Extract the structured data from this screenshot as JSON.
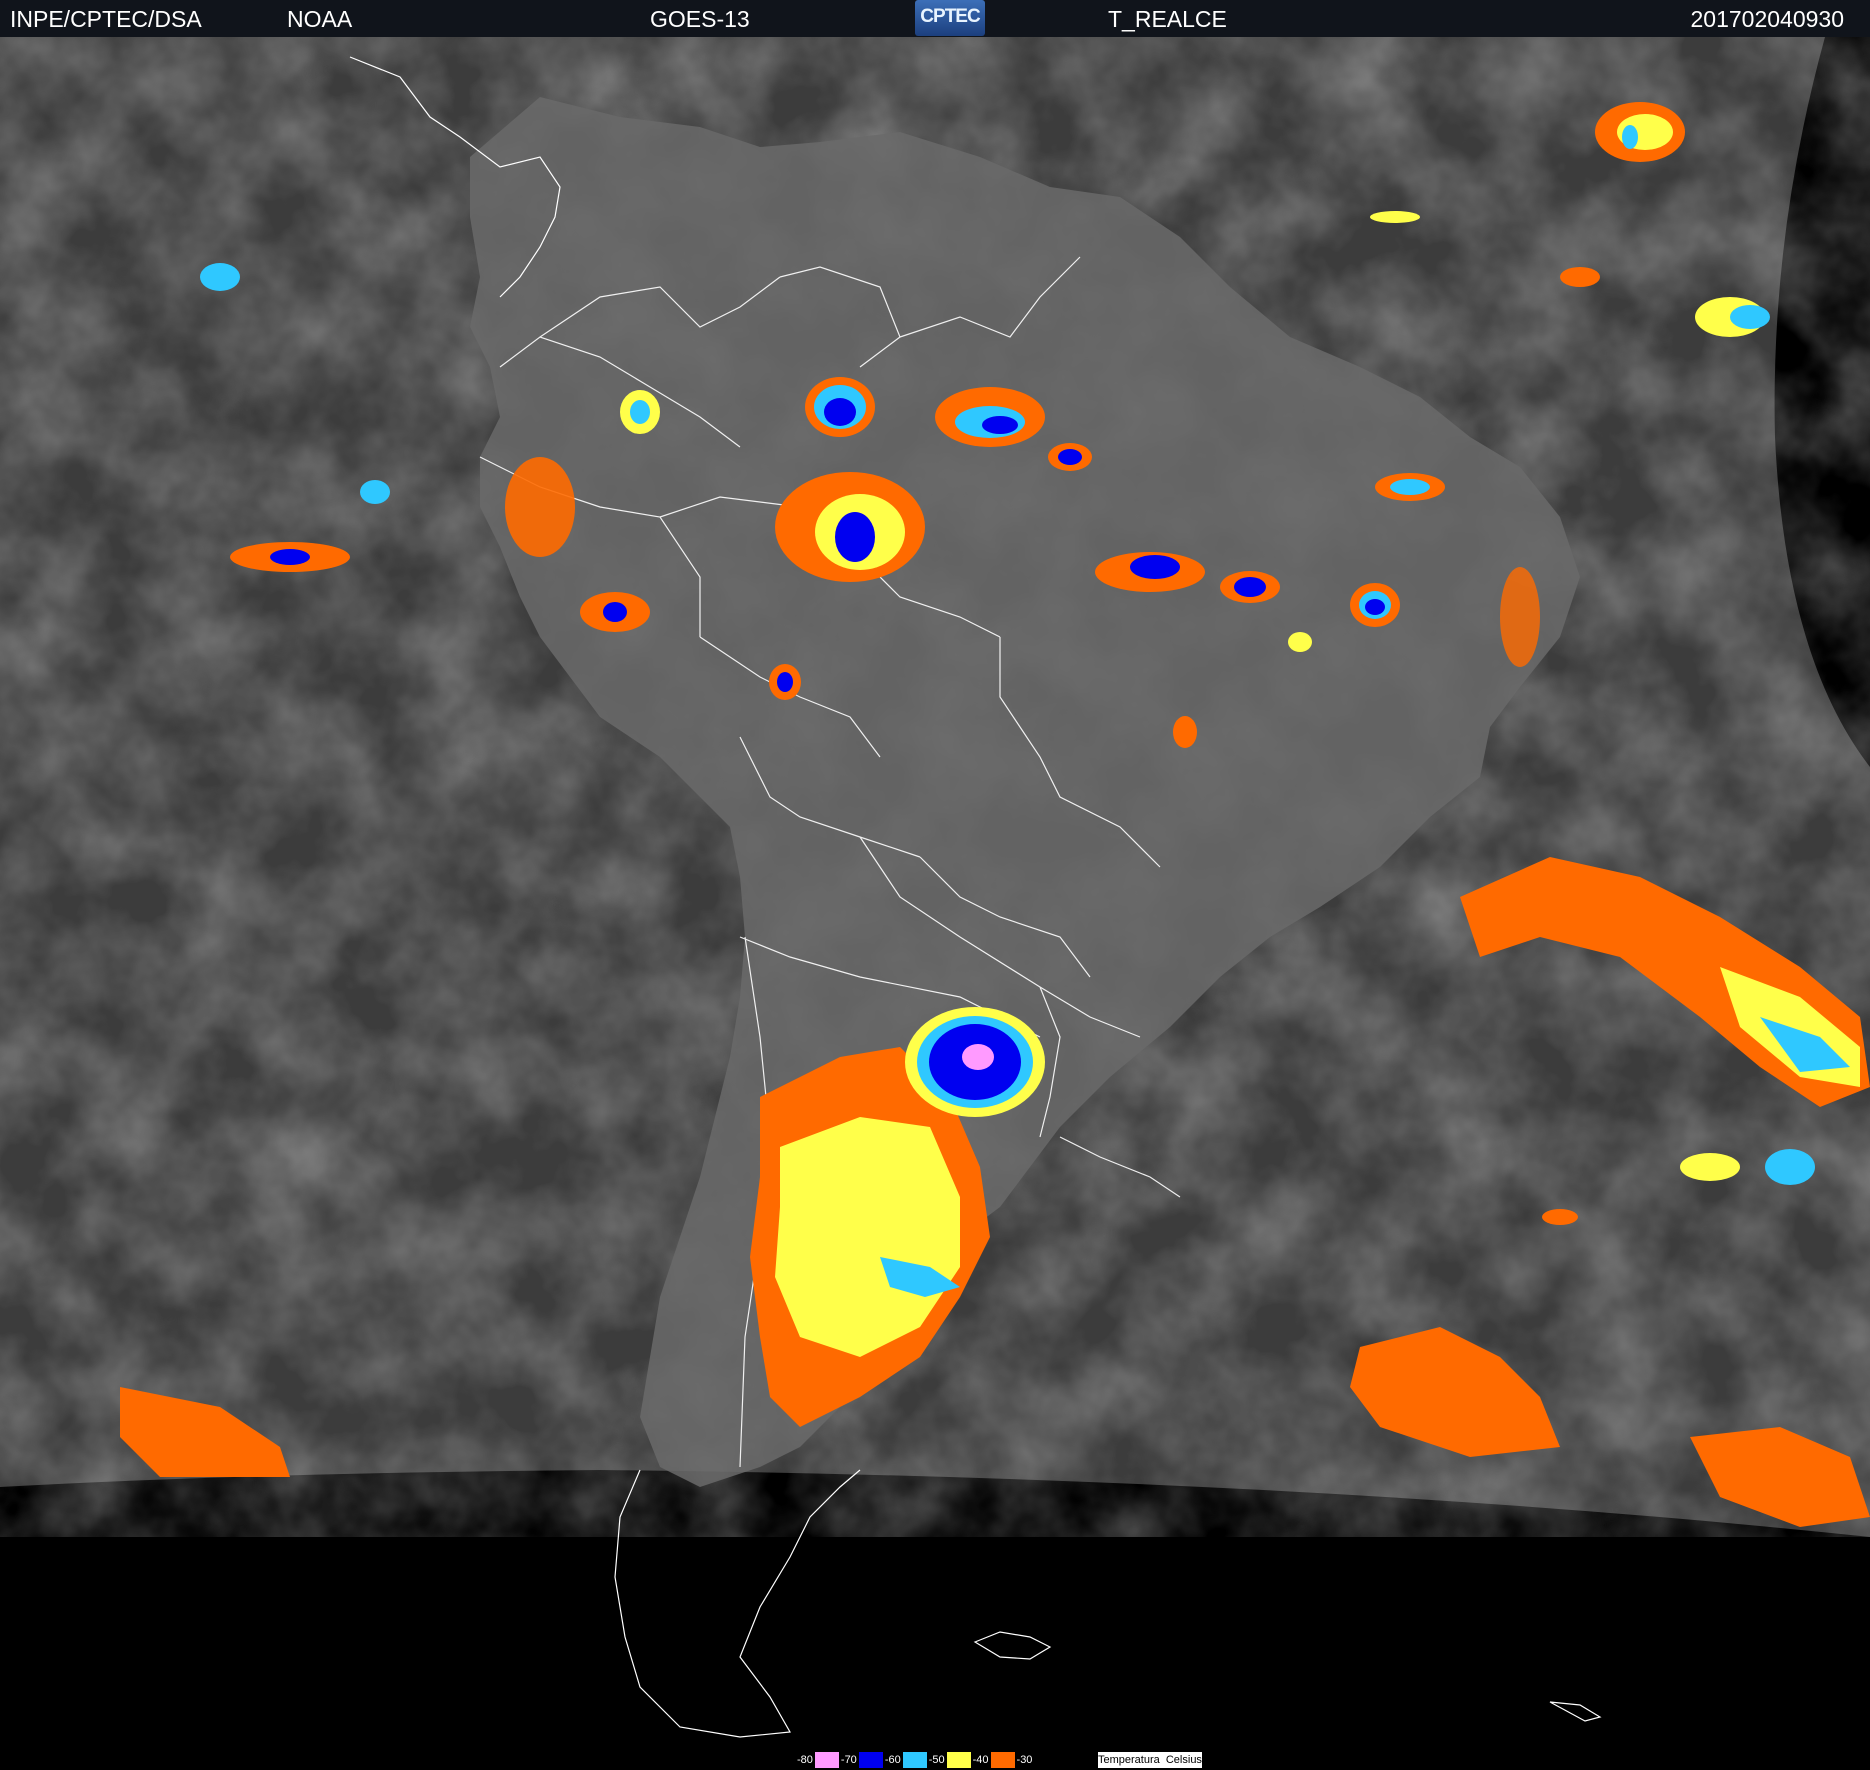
{
  "header": {
    "organization": "INPE/CPTEC/DSA",
    "agency": "NOAA",
    "satellite": "GOES-13",
    "logo_text": "CPTEC",
    "product": "T_REALCE",
    "timestamp": "201702040930"
  },
  "legend": {
    "title": "Temperatura  Celsius",
    "items": [
      {
        "label": "-80",
        "color": "#ff9aff"
      },
      {
        "label": "-70",
        "color": "#0000f0"
      },
      {
        "label": "-60",
        "color": "#2fc8ff"
      },
      {
        "label": "-50",
        "color": "#ffff4a"
      },
      {
        "label": "-40",
        "color": "#ff6a00"
      },
      {
        "label": "-30",
        "color": "#000000"
      }
    ]
  },
  "colors": {
    "ocean": "#3b3b3b",
    "land": "#686868",
    "space": "#000000",
    "borders": "#ffffff"
  }
}
